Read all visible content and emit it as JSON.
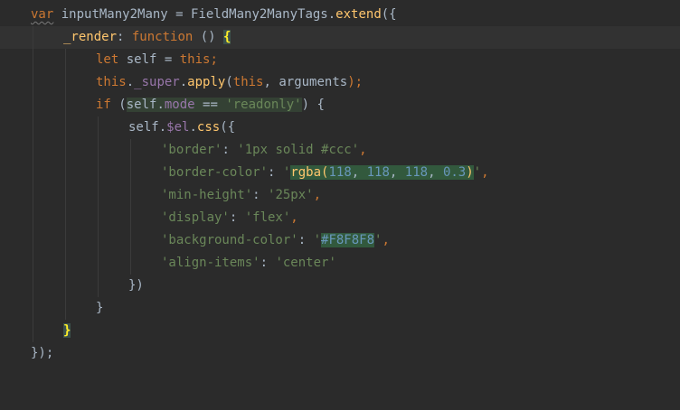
{
  "editor": {
    "colors": {
      "background": "#2b2b2b",
      "current_line": "#323232",
      "keyword": "#cc7832",
      "identifier": "#a9b7c6",
      "function": "#ffc66d",
      "property": "#9876aa",
      "string": "#6a8759",
      "number": "#6897bb"
    },
    "lines": [
      {
        "tokens": [
          "var",
          " inputMany2Many = ",
          "FieldMany2ManyTags",
          ".",
          "extend",
          "({"
        ]
      },
      {
        "tokens": [
          "_render",
          ": ",
          "function",
          " () ",
          "{"
        ]
      },
      {
        "tokens": [
          "let",
          " self = ",
          "this",
          ";"
        ]
      },
      {
        "tokens": [
          "this",
          ".",
          "_super",
          ".",
          "apply",
          "(",
          "this",
          ", ",
          "arguments",
          ");"
        ]
      },
      {
        "tokens": [
          "if",
          " (",
          "self",
          ".",
          "mode",
          " == ",
          "'readonly'",
          ") {"
        ]
      },
      {
        "tokens": [
          "self",
          ".",
          "$el",
          ".",
          "css",
          "({"
        ]
      },
      {
        "tokens": [
          "'border'",
          ": ",
          "'1px solid #ccc'",
          ","
        ]
      },
      {
        "tokens": [
          "'border-color'",
          ": ",
          "'",
          "rgba(",
          "118",
          ", ",
          "118",
          ", ",
          "118",
          ", ",
          "0.3",
          ")",
          "'",
          ","
        ]
      },
      {
        "tokens": [
          "'min-height'",
          ": ",
          "'25px'",
          ","
        ]
      },
      {
        "tokens": [
          "'display'",
          ": ",
          "'flex'",
          ","
        ]
      },
      {
        "tokens": [
          "'background-color'",
          ": ",
          "'",
          "#F8F8F8",
          "'",
          ","
        ]
      },
      {
        "tokens": [
          "'align-items'",
          ": ",
          "'center'"
        ]
      },
      {
        "tokens": [
          "})"
        ]
      },
      {
        "tokens": [
          "}"
        ]
      },
      {
        "tokens": [
          "}"
        ]
      },
      {
        "tokens": [
          "});"
        ]
      }
    ]
  }
}
